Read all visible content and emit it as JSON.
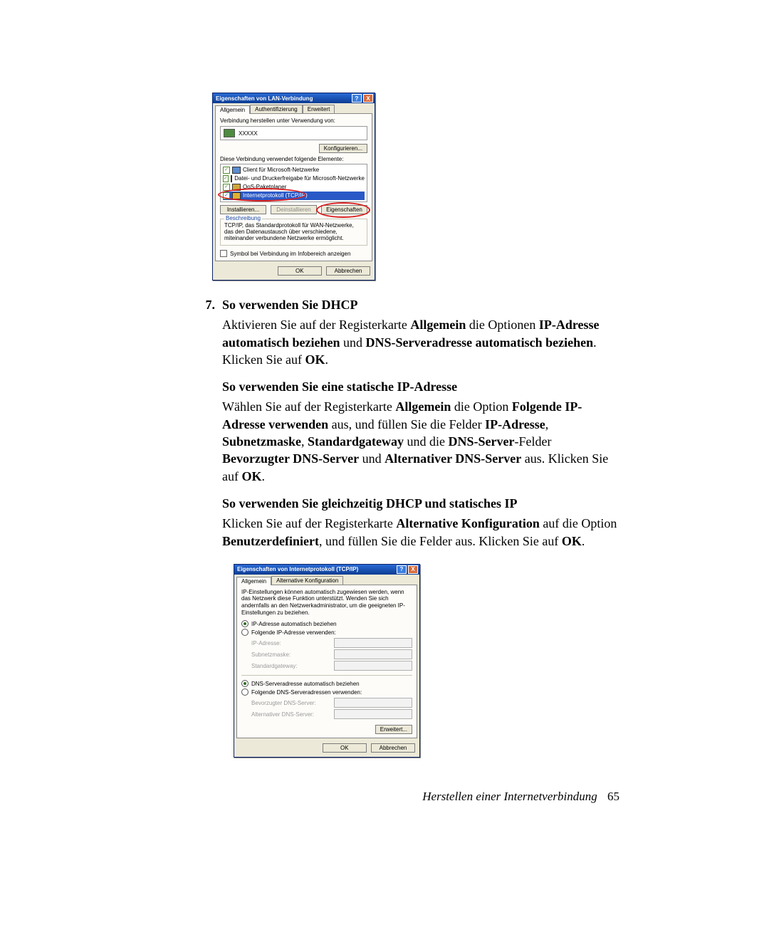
{
  "step_number": "7.",
  "step_title": "So verwenden Sie DHCP",
  "p1_a": "Aktivieren Sie auf der Registerkarte ",
  "p1_b1": "Allgemein",
  "p1_c": " die Optionen ",
  "p1_b2": "IP-Adresse automatisch beziehen",
  "p1_d": " und ",
  "p1_b3": "DNS-Serveradresse automatisch beziehen",
  "p1_e": ". Klicken Sie auf ",
  "p1_b4": "OK",
  "p1_f": ".",
  "h2": "So verwenden Sie eine statische IP-Adresse",
  "p2_a": "Wählen Sie auf der Registerkarte ",
  "p2_b1": "Allgemein",
  "p2_b": " die Option ",
  "p2_b2": "Folgende IP-Adresse verwenden",
  "p2_c": " aus, und füllen Sie die Felder ",
  "p2_b3": "IP-Adresse",
  "p2_d": ", ",
  "p2_b4": "Subnetzmaske",
  "p2_e": ", ",
  "p2_b5": "Standardgateway",
  "p2_f": " und die ",
  "p2_b6": "DNS-Server",
  "p2_g": "-Felder ",
  "p2_b7": "Bevorzugter DNS-Server",
  "p2_h": " und ",
  "p2_b8": "Alternativer DNS-Server",
  "p2_i": " aus. Klicken Sie auf ",
  "p2_b9": "OK",
  "p2_j": ".",
  "h3": "So verwenden Sie gleichzeitig DHCP und statisches IP",
  "p3_a": "Klicken Sie auf der Registerkarte ",
  "p3_b1": "Alternative Konfiguration",
  "p3_b": " auf die Option ",
  "p3_b2": "Benutzerdefiniert",
  "p3_c": ", und füllen Sie die Felder aus. Klicken Sie auf ",
  "p3_b3": "OK",
  "p3_d": ".",
  "footer_text": "Herstellen einer Internetverbindung",
  "footer_page": "65",
  "dlg1": {
    "title": "Eigenschaften von LAN-Verbindung",
    "tabs": [
      "Allgemein",
      "Authentifizierung",
      "Erweitert"
    ],
    "connect_using_label": "Verbindung herstellen unter Verwendung von:",
    "adapter": "XXXXX",
    "configure": "Konfigurieren...",
    "elements_label": "Diese Verbindung verwendet folgende Elemente:",
    "items": [
      "Client für Microsoft-Netzwerke",
      "Datei- und Druckerfreigabe für Microsoft-Netzwerke",
      "QoS-Paketplaner",
      "Internetprotokoll (TCP/IP)"
    ],
    "install": "Installieren...",
    "uninstall": "Deinstallieren",
    "props": "Eigenschaften",
    "desc_legend": "Beschreibung",
    "desc_text": "TCP/IP, das Standardprotokoll für WAN-Netzwerke, das den Datenaustausch über verschiedene, miteinander verbundene Netzwerke ermöglicht.",
    "show_icon": "Symbol bei Verbindung im Infobereich anzeigen",
    "ok": "OK",
    "cancel": "Abbrechen"
  },
  "dlg2": {
    "title": "Eigenschaften von Internetprotokoll (TCP/IP)",
    "tabs": [
      "Allgemein",
      "Alternative Konfiguration"
    ],
    "intro": "IP-Einstellungen können automatisch zugewiesen werden, wenn das Netzwerk diese Funktion unterstützt. Wenden Sie sich andernfalls an den Netzwerkadministrator, um die geeigneten IP-Einstellungen zu beziehen.",
    "r_auto_ip": "IP-Adresse automatisch beziehen",
    "r_manual_ip": "Folgende IP-Adresse verwenden:",
    "lbl_ip": "IP-Adresse:",
    "lbl_mask": "Subnetzmaske:",
    "lbl_gw": "Standardgateway:",
    "r_auto_dns": "DNS-Serveradresse automatisch beziehen",
    "r_manual_dns": "Folgende DNS-Serveradressen verwenden:",
    "lbl_dns1": "Bevorzugter DNS-Server:",
    "lbl_dns2": "Alternativer DNS-Server:",
    "advanced": "Erweitert...",
    "ok": "OK",
    "cancel": "Abbrechen"
  }
}
